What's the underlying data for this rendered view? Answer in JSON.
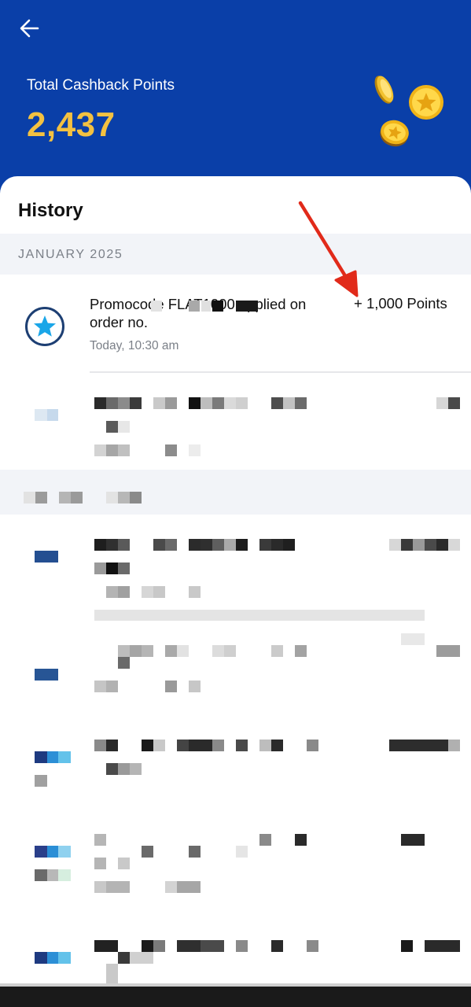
{
  "header": {
    "back_icon": "arrow-left-icon",
    "total_label": "Total Cashback Points",
    "total_value": "2,437",
    "coins_icon": "gold-coins-icon"
  },
  "history": {
    "title": "History",
    "month": "JANUARY 2025",
    "transaction": {
      "icon": "star-circle-icon",
      "title_line1": "Promocode FLAT1000 applied on",
      "title_line2": "order no.",
      "points": "+ 1,000 Points",
      "time": "Today, 10:30 am"
    }
  },
  "colors": {
    "header_bg": "#0a3fa8",
    "accent_yellow": "#f3c141",
    "star_blue": "#1aa6e8",
    "arrow_red": "#e12a1a"
  }
}
